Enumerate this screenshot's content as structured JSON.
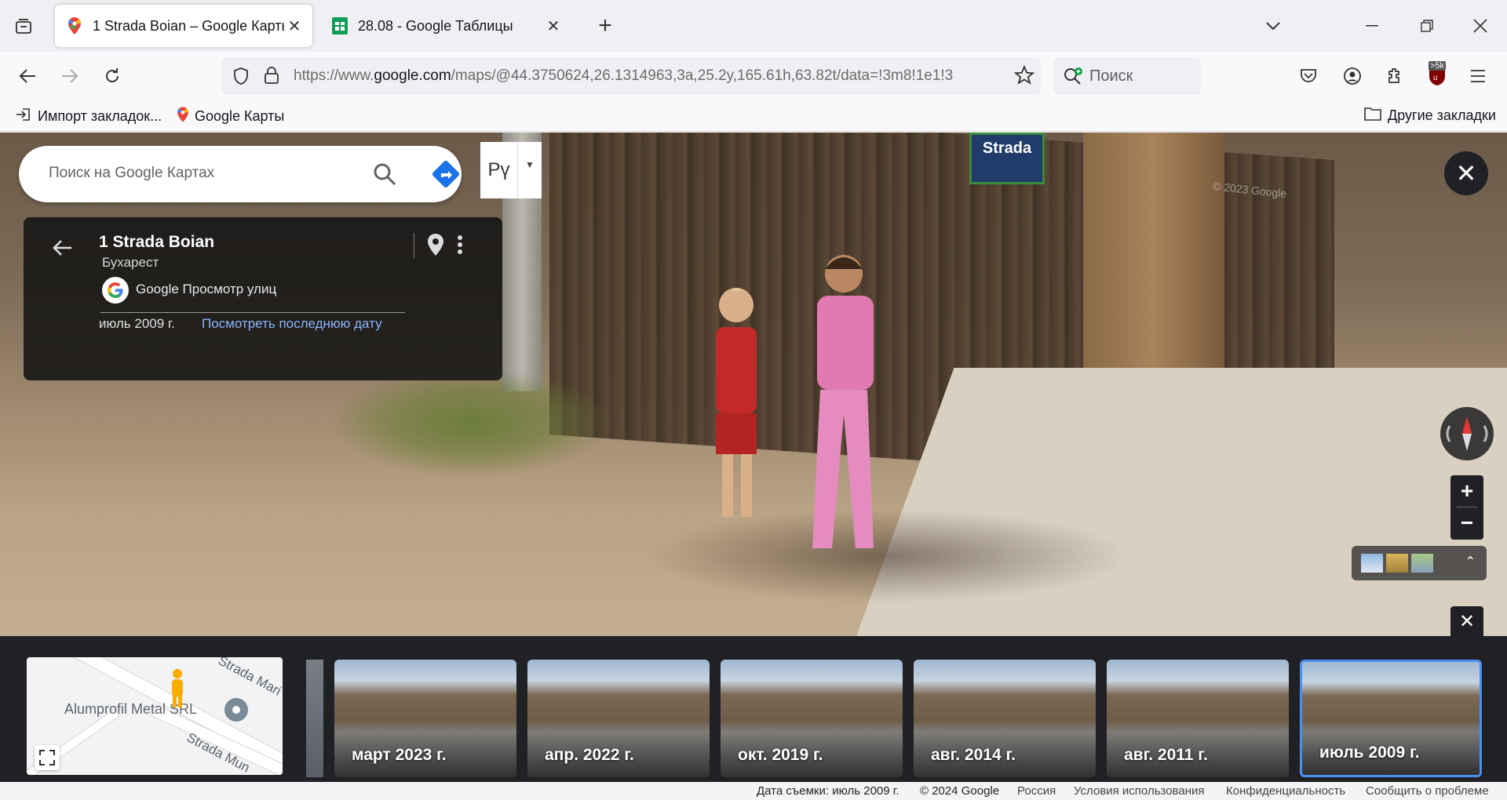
{
  "browser": {
    "tabs": [
      {
        "title": "1 Strada Boian – Google Карты",
        "active": true,
        "icon": "google-maps-pin-icon"
      },
      {
        "title": "28.08 - Google Таблицы",
        "active": false,
        "icon": "google-sheets-icon"
      }
    ],
    "url_prefix": "https://www.",
    "url_domain": "google.com",
    "url_rest": "/maps/@44.3750624,26.1314963,3a,25.2y,165.61h,63.82t/data=!3m8!1e1!3",
    "search_placeholder": "Поиск",
    "extension_badge": ">5k",
    "bookmarks": [
      {
        "label": "Импорт закладок...",
        "icon": "import-icon"
      },
      {
        "label": "Google Карты",
        "icon": "google-maps-pin-icon"
      }
    ],
    "other_bookmarks": "Другие закладки"
  },
  "maps": {
    "search_placeholder": "Поиск на Google Картах",
    "ime_lang": "Рү",
    "street_sign": "Strada",
    "watermark": "© 2023 Google",
    "info": {
      "title": "1 Strada Boian",
      "city": "Бухарест",
      "provider": "Google Просмотр улиц",
      "date": "июль 2009 г.",
      "latest_link": "Посмотреть последнюю дату"
    },
    "minimap": {
      "street1": "Strada Mari",
      "street2": "Strada Mun",
      "place": "Alumprofil Metal SRL"
    },
    "timeline": [
      {
        "label": "март 2023 г.",
        "selected": false
      },
      {
        "label": "апр. 2022 г.",
        "selected": false
      },
      {
        "label": "окт. 2019 г.",
        "selected": false
      },
      {
        "label": "авг. 2014 г.",
        "selected": false
      },
      {
        "label": "авг. 2011 г.",
        "selected": false
      },
      {
        "label": "июль 2009 г.",
        "selected": true
      }
    ],
    "footer": {
      "capture_date": "Дата съемки: июль 2009 г.",
      "copyright": "© 2024 Google",
      "country": "Россия",
      "terms": "Условия использования",
      "privacy": "Конфиденциальность",
      "report": "Сообщить о проблеме"
    }
  }
}
